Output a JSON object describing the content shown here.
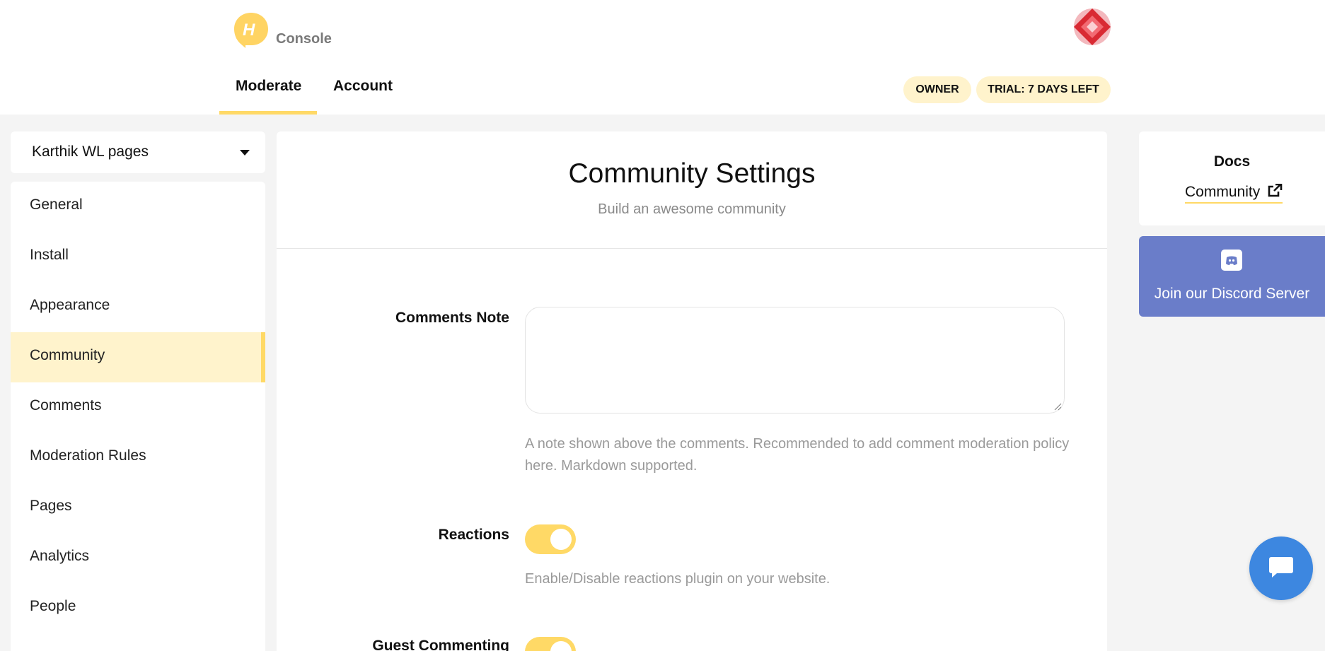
{
  "header": {
    "brand": "Console",
    "logo_letter": "H",
    "tabs": [
      {
        "label": "Moderate",
        "active": true
      },
      {
        "label": "Account",
        "active": false
      }
    ],
    "badges": [
      "OWNER",
      "TRIAL: 7 DAYS LEFT"
    ]
  },
  "sidebar": {
    "site_select": "Karthik WL pages",
    "items": [
      {
        "label": "General"
      },
      {
        "label": "Install"
      },
      {
        "label": "Appearance"
      },
      {
        "label": "Community",
        "active": true
      },
      {
        "label": "Comments"
      },
      {
        "label": "Moderation Rules"
      },
      {
        "label": "Pages"
      },
      {
        "label": "Analytics"
      },
      {
        "label": "People"
      }
    ]
  },
  "main": {
    "title": "Community Settings",
    "subtitle": "Build an awesome community",
    "fields": {
      "comments_note": {
        "label": "Comments Note",
        "value": "",
        "help": "A note shown above the comments. Recommended to add comment moderation policy here. Markdown supported."
      },
      "reactions": {
        "label": "Reactions",
        "enabled": true,
        "help": "Enable/Disable reactions plugin on your website."
      },
      "guest_commenting": {
        "label": "Guest Commenting",
        "enabled": true
      }
    }
  },
  "right_panel": {
    "docs_title": "Docs",
    "docs_link": "Community",
    "discord_label": "Join our Discord Server"
  },
  "colors": {
    "accent": "#ffd966",
    "accent_light": "#fff3cc",
    "discord": "#6a7dc9",
    "chat": "#3d87e0"
  }
}
